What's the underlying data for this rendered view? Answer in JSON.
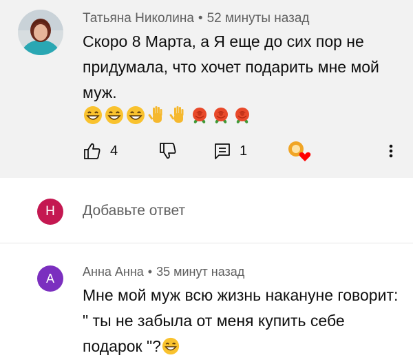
{
  "comment": {
    "author": "Татьяна Николина",
    "separator": "•",
    "time": "52 минуты назад",
    "text": "Скоро 8 Марта, а Я еще до сих пор не придумала, что хочет подарить мне мой муж.",
    "emojis": [
      "grinning-face-icon",
      "grinning-face-icon",
      "grinning-face-icon",
      "raised-hand-icon",
      "raised-hand-icon",
      "rose-icon",
      "rose-icon",
      "rose-icon"
    ],
    "likes": "4",
    "replies": "1",
    "colors": {
      "card_bg": "#f2f2f2",
      "heart": "#ff0000"
    }
  },
  "reply_box": {
    "avatar_letter": "Н",
    "placeholder": "Добавьте ответ",
    "avatar_color": "#c41851"
  },
  "reply": {
    "avatar_letter": "А",
    "avatar_color": "#7b2fbf",
    "author": "Анна Анна",
    "separator": "•",
    "time": "35 минут назад",
    "text": "Мне мой муж всю жизнь накануне говорит: \" ты не забыла от меня купить себе подарок \"?",
    "trailing_emoji": "grinning-face-icon"
  }
}
